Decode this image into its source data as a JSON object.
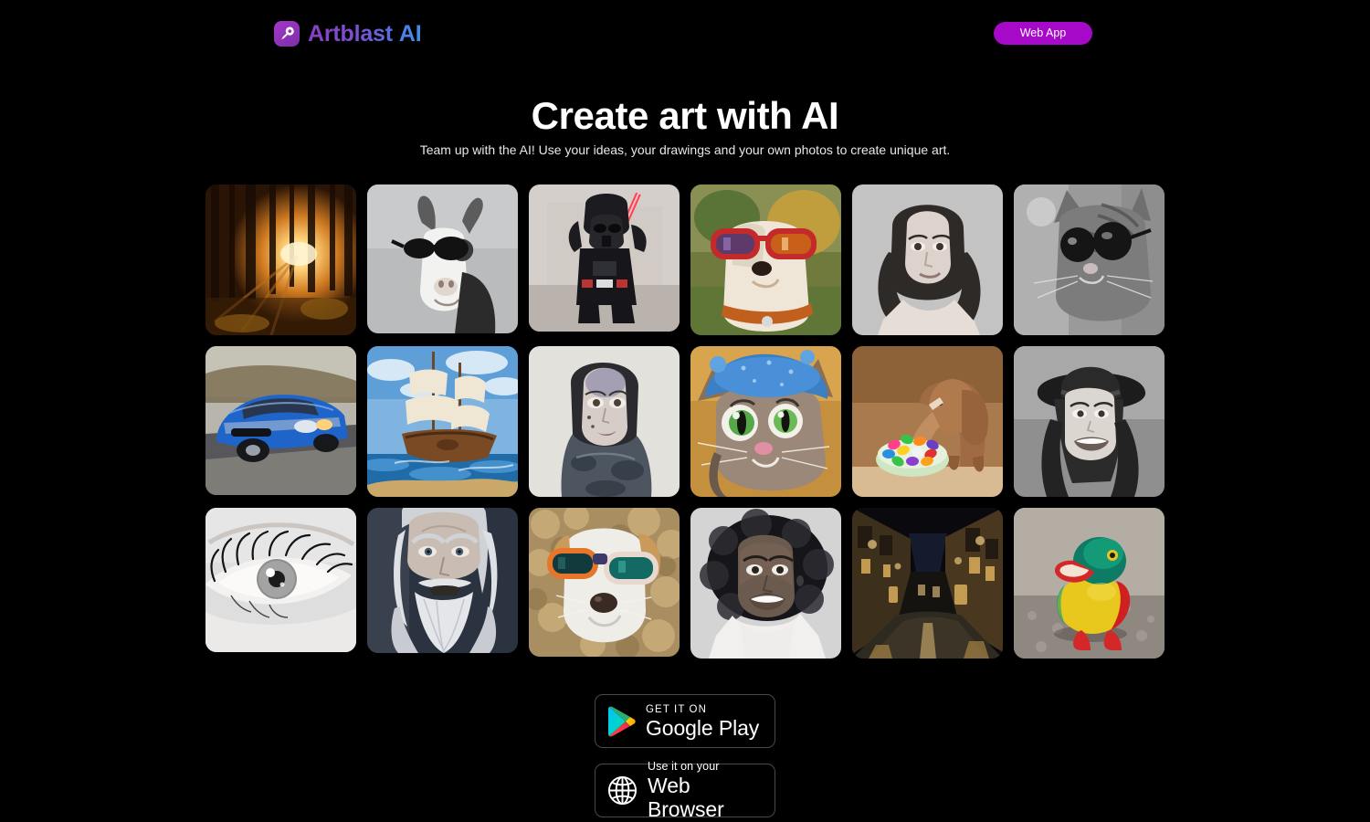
{
  "header": {
    "brand_name": "Artblast",
    "brand_suffix": "AI",
    "brand_icon": "artblast-logo-icon",
    "webapp_button": "Web App",
    "accent_purple": "#a609c8",
    "brand_gradient_from": "#8b3fc4",
    "brand_gradient_to": "#3f8fe8"
  },
  "hero": {
    "title": "Create art with AI",
    "subtitle": "Team up with the AI! Use your ideas, your drawings and your own photos to create unique art."
  },
  "gallery": {
    "columns": 6,
    "rows": 3,
    "tiles": [
      {
        "alt": "Sunlit pine forest with golden sunbeams",
        "theme": "forest-sunset"
      },
      {
        "alt": "Black and white goat wearing dark sunglasses",
        "theme": "goat-sunglasses"
      },
      {
        "alt": "Darth Vader toy figurine with red lightsaber",
        "theme": "vader-figurine"
      },
      {
        "alt": "Dog wearing large red sunglasses outdoors",
        "theme": "dog-red-sunglasses"
      },
      {
        "alt": "Black and white portrait of a young woman",
        "theme": "woman-portrait-bw"
      },
      {
        "alt": "Black and white cat wearing round sunglasses",
        "theme": "cat-sunglasses-bw"
      },
      {
        "alt": "Blue sports car driving on a road",
        "theme": "blue-mustang"
      },
      {
        "alt": "Tall ship with white sails on blue ocean",
        "theme": "sailing-ship"
      },
      {
        "alt": "Painted sketch portrait of a pale woman",
        "theme": "sketch-portrait"
      },
      {
        "alt": "Tabby cat wearing a blue knitted hat",
        "theme": "cat-blue-hat"
      },
      {
        "alt": "Wooden elephant toy beside a bowl of colorful candy",
        "theme": "wooden-elephant"
      },
      {
        "alt": "Black and white smiling woman wearing a fedora hat",
        "theme": "woman-hat-bw"
      },
      {
        "alt": "Black and white close-up of an eye with long lashes",
        "theme": "eye-closeup"
      },
      {
        "alt": "Elderly wizard with long white hair and beard",
        "theme": "wizard-portrait"
      },
      {
        "alt": "White curly dog wearing orange sunglasses",
        "theme": "dog-orange-sunglasses"
      },
      {
        "alt": "Black and white smiling woman with afro hair",
        "theme": "woman-afro-bw"
      },
      {
        "alt": "Narrow cobblestone street at night with warm lamps",
        "theme": "night-street"
      },
      {
        "alt": "Colorful painted wooden toy duck",
        "theme": "toy-duck"
      }
    ]
  },
  "store_badges": [
    {
      "icon": "google-play-icon",
      "line1": "GET IT ON",
      "line2": "Google Play"
    },
    {
      "icon": "globe-icon",
      "line1": "Use it on your",
      "line2": "Web Browser"
    }
  ]
}
